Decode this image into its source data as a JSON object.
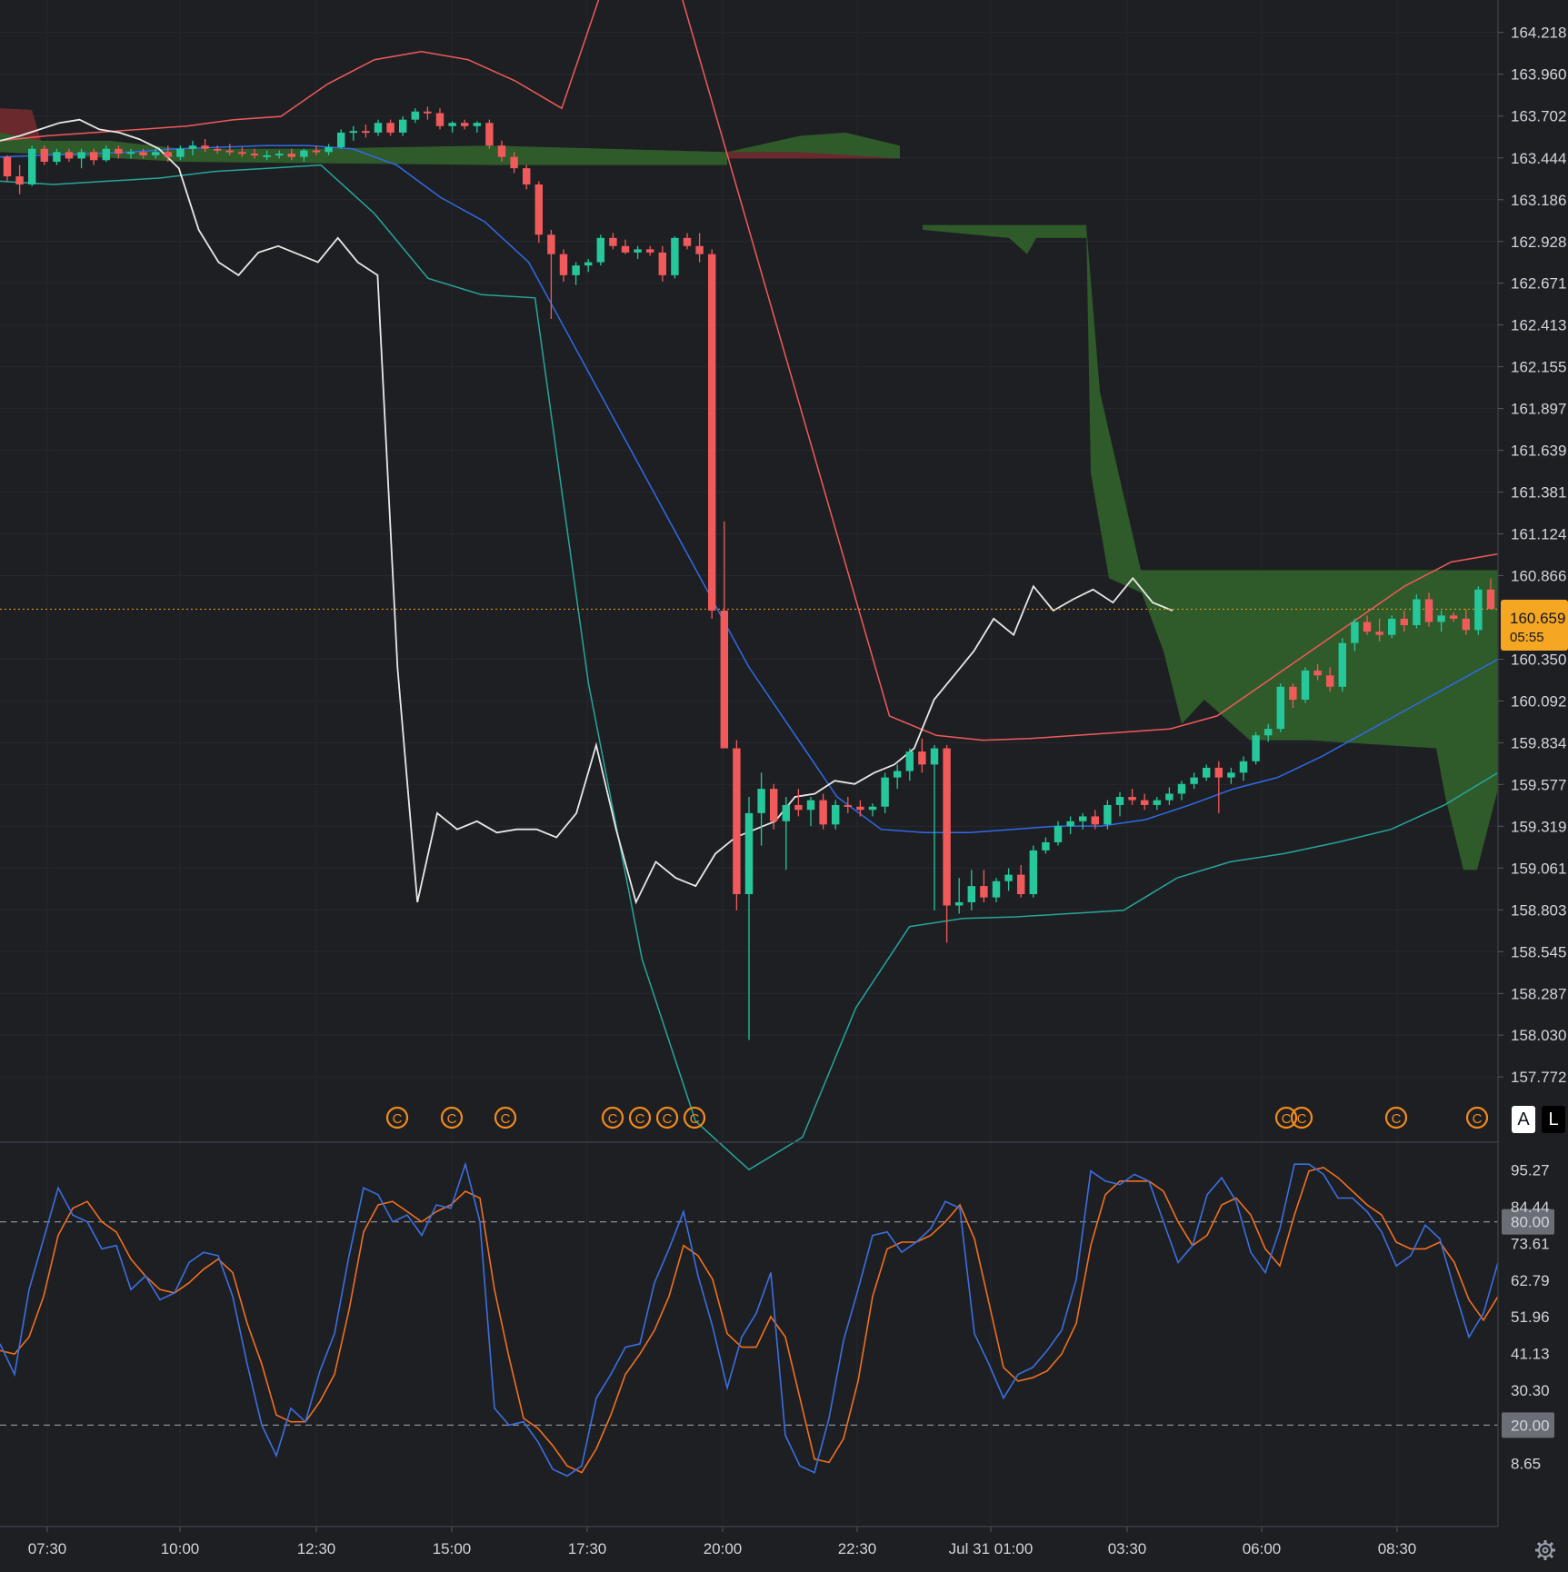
{
  "chart_data": [
    {
      "type": "candlestick",
      "panel": "price",
      "y_ticks": [
        "164.218",
        "163.960",
        "163.702",
        "163.444",
        "163.186",
        "162.928",
        "162.671",
        "162.413",
        "162.155",
        "161.897",
        "161.639",
        "161.381",
        "161.124",
        "160.866",
        "160.350",
        "160.092",
        "159.834",
        "159.577",
        "159.319",
        "159.061",
        "158.803",
        "158.545",
        "158.287",
        "158.030",
        "157.772"
      ],
      "ylim": [
        157.7,
        164.35
      ],
      "x_labels": [
        "07:30",
        "10:00",
        "12:30",
        "15:00",
        "17:30",
        "20:00",
        "22:30",
        "Jul 31 01:00",
        "03:30",
        "06:00",
        "08:30"
      ],
      "current_price": "160.659",
      "countdown": "05:55",
      "colors": {
        "up": "#26c79b",
        "down": "#f05a5a",
        "cloud_green": "#3d6b35",
        "cloud_red": "#7a2a2e",
        "price_line": "#f0a020"
      },
      "candles_ohlc": [
        [
          163.45,
          163.46,
          163.3,
          163.33
        ],
        [
          163.33,
          163.4,
          163.22,
          163.28
        ],
        [
          163.28,
          163.52,
          163.27,
          163.5
        ],
        [
          163.5,
          163.52,
          163.4,
          163.42
        ],
        [
          163.42,
          163.5,
          163.4,
          163.48
        ],
        [
          163.48,
          163.5,
          163.42,
          163.44
        ],
        [
          163.44,
          163.5,
          163.38,
          163.48
        ],
        [
          163.48,
          163.5,
          163.4,
          163.43
        ],
        [
          163.43,
          163.52,
          163.42,
          163.5
        ],
        [
          163.5,
          163.52,
          163.44,
          163.47
        ],
        [
          163.47,
          163.5,
          163.44,
          163.48
        ],
        [
          163.48,
          163.5,
          163.44,
          163.46
        ],
        [
          163.46,
          163.5,
          163.44,
          163.48
        ],
        [
          163.48,
          163.52,
          163.42,
          163.45
        ],
        [
          163.45,
          163.52,
          163.43,
          163.5
        ],
        [
          163.5,
          163.55,
          163.46,
          163.52
        ],
        [
          163.52,
          163.56,
          163.48,
          163.5
        ],
        [
          163.5,
          163.52,
          163.47,
          163.49
        ],
        [
          163.49,
          163.53,
          163.46,
          163.48
        ],
        [
          163.48,
          163.51,
          163.45,
          163.47
        ],
        [
          163.47,
          163.5,
          163.44,
          163.46
        ],
        [
          163.46,
          163.49,
          163.43,
          163.46
        ],
        [
          163.46,
          163.49,
          163.44,
          163.47
        ],
        [
          163.47,
          163.5,
          163.43,
          163.45
        ],
        [
          163.45,
          163.5,
          163.42,
          163.49
        ],
        [
          163.49,
          163.52,
          163.46,
          163.48
        ],
        [
          163.48,
          163.53,
          163.46,
          163.51
        ],
        [
          163.51,
          163.62,
          163.5,
          163.6
        ],
        [
          163.6,
          163.64,
          163.55,
          163.61
        ],
        [
          163.61,
          163.65,
          163.57,
          163.6
        ],
        [
          163.6,
          163.68,
          163.58,
          163.66
        ],
        [
          163.66,
          163.68,
          163.58,
          163.6
        ],
        [
          163.6,
          163.7,
          163.58,
          163.68
        ],
        [
          163.68,
          163.75,
          163.66,
          163.73
        ],
        [
          163.73,
          163.76,
          163.68,
          163.72
        ],
        [
          163.72,
          163.75,
          163.62,
          163.64
        ],
        [
          163.64,
          163.67,
          163.6,
          163.66
        ],
        [
          163.66,
          163.68,
          163.62,
          163.64
        ],
        [
          163.64,
          163.67,
          163.6,
          163.66
        ],
        [
          163.66,
          163.68,
          163.5,
          163.52
        ],
        [
          163.52,
          163.55,
          163.42,
          163.45
        ],
        [
          163.45,
          163.48,
          163.35,
          163.38
        ],
        [
          163.38,
          163.4,
          163.25,
          163.28
        ],
        [
          163.28,
          163.3,
          162.92,
          162.97
        ],
        [
          162.97,
          163.0,
          162.45,
          162.85
        ],
        [
          162.85,
          162.88,
          162.68,
          162.72
        ],
        [
          162.72,
          162.8,
          162.66,
          162.78
        ],
        [
          162.78,
          162.82,
          162.74,
          162.8
        ],
        [
          162.8,
          162.97,
          162.78,
          162.95
        ],
        [
          162.95,
          162.98,
          162.88,
          162.9
        ],
        [
          162.9,
          162.94,
          162.85,
          162.86
        ],
        [
          162.86,
          162.9,
          162.82,
          162.88
        ],
        [
          162.88,
          162.9,
          162.84,
          162.86
        ],
        [
          162.86,
          162.9,
          162.68,
          162.72
        ],
        [
          162.72,
          162.96,
          162.7,
          162.95
        ],
        [
          162.95,
          162.98,
          162.88,
          162.9
        ],
        [
          162.9,
          162.98,
          162.8,
          162.85
        ],
        [
          162.85,
          162.88,
          160.6,
          160.65
        ],
        [
          160.65,
          161.2,
          159.8,
          159.8
        ],
        [
          159.8,
          159.85,
          158.8,
          158.9
        ],
        [
          158.9,
          159.5,
          158.0,
          159.4
        ],
        [
          159.4,
          159.65,
          159.2,
          159.55
        ],
        [
          159.55,
          159.58,
          159.3,
          159.35
        ],
        [
          159.35,
          159.5,
          159.05,
          159.45
        ],
        [
          159.45,
          159.55,
          159.38,
          159.42
        ],
        [
          159.42,
          159.5,
          159.32,
          159.48
        ],
        [
          159.48,
          159.52,
          159.3,
          159.33
        ],
        [
          159.33,
          159.48,
          159.3,
          159.45
        ],
        [
          159.45,
          159.5,
          159.4,
          159.44
        ],
        [
          159.44,
          159.48,
          159.38,
          159.42
        ],
        [
          159.42,
          159.46,
          159.38,
          159.44
        ],
        [
          159.44,
          159.65,
          159.4,
          159.62
        ],
        [
          159.62,
          159.7,
          159.55,
          159.66
        ],
        [
          159.66,
          159.8,
          159.6,
          159.78
        ],
        [
          159.78,
          159.86,
          159.65,
          159.7
        ],
        [
          159.7,
          159.82,
          158.8,
          159.8
        ],
        [
          159.8,
          159.82,
          158.6,
          158.83
        ],
        [
          158.83,
          159.0,
          158.78,
          158.85
        ],
        [
          158.85,
          159.05,
          158.8,
          158.95
        ],
        [
          158.95,
          159.05,
          158.85,
          158.88
        ],
        [
          158.88,
          159.0,
          158.85,
          158.98
        ],
        [
          158.98,
          159.06,
          158.92,
          159.02
        ],
        [
          159.02,
          159.08,
          158.88,
          158.9
        ],
        [
          158.9,
          159.2,
          158.88,
          159.17
        ],
        [
          159.17,
          159.25,
          159.15,
          159.22
        ],
        [
          159.22,
          159.35,
          159.2,
          159.32
        ],
        [
          159.32,
          159.38,
          159.27,
          159.35
        ],
        [
          159.35,
          159.4,
          159.3,
          159.38
        ],
        [
          159.38,
          159.42,
          159.3,
          159.33
        ],
        [
          159.33,
          159.48,
          159.3,
          159.45
        ],
        [
          159.45,
          159.53,
          159.38,
          159.5
        ],
        [
          159.5,
          159.55,
          159.45,
          159.48
        ],
        [
          159.48,
          159.52,
          159.42,
          159.45
        ],
        [
          159.45,
          159.5,
          159.42,
          159.48
        ],
        [
          159.48,
          159.56,
          159.45,
          159.52
        ],
        [
          159.52,
          159.6,
          159.48,
          159.58
        ],
        [
          159.58,
          159.65,
          159.55,
          159.62
        ],
        [
          159.62,
          159.7,
          159.6,
          159.68
        ],
        [
          159.68,
          159.72,
          159.4,
          159.62
        ],
        [
          159.62,
          159.68,
          159.58,
          159.65
        ],
        [
          159.65,
          159.75,
          159.6,
          159.72
        ],
        [
          159.72,
          159.9,
          159.7,
          159.88
        ],
        [
          159.88,
          159.95,
          159.84,
          159.92
        ],
        [
          159.92,
          160.2,
          159.9,
          160.18
        ],
        [
          160.18,
          160.2,
          160.05,
          160.1
        ],
        [
          160.1,
          160.3,
          160.08,
          160.28
        ],
        [
          160.28,
          160.32,
          160.22,
          160.25
        ],
        [
          160.25,
          160.3,
          160.15,
          160.18
        ],
        [
          160.18,
          160.48,
          160.15,
          160.45
        ],
        [
          160.45,
          160.6,
          160.4,
          160.58
        ],
        [
          160.58,
          160.62,
          160.5,
          160.52
        ],
        [
          160.52,
          160.6,
          160.46,
          160.5
        ],
        [
          160.5,
          160.62,
          160.48,
          160.6
        ],
        [
          160.6,
          160.65,
          160.52,
          160.56
        ],
        [
          160.56,
          160.75,
          160.54,
          160.72
        ],
        [
          160.72,
          160.76,
          160.55,
          160.58
        ],
        [
          160.58,
          160.65,
          160.52,
          160.62
        ],
        [
          160.62,
          160.64,
          160.58,
          160.6
        ],
        [
          160.6,
          160.66,
          160.5,
          160.53
        ],
        [
          160.53,
          160.8,
          160.5,
          160.78
        ],
        [
          160.78,
          160.85,
          160.72,
          160.66
        ]
      ],
      "series": [
        {
          "label": "white line",
          "color": "#e8e8e8",
          "values": [
            163.55,
            163.58,
            163.62,
            163.66,
            163.68,
            163.62,
            163.6,
            163.56,
            163.5,
            163.38,
            163.0,
            162.8,
            162.72,
            162.86,
            162.9,
            162.85,
            162.8,
            162.95,
            162.8,
            162.72,
            160.3,
            158.85,
            159.4,
            159.3,
            159.35,
            159.28,
            159.3,
            159.3,
            159.25,
            159.4,
            159.82,
            159.3,
            158.85,
            159.1,
            159.0,
            158.95,
            159.15,
            159.25,
            159.3,
            159.35,
            159.5,
            159.52,
            159.6,
            159.58,
            159.65,
            159.7,
            159.8,
            160.1,
            160.25,
            160.4,
            160.6,
            160.5,
            160.8,
            160.65,
            160.72,
            160.78,
            160.7,
            160.85,
            160.7,
            160.65
          ]
        },
        {
          "label": "Bollinger basis",
          "color": "#2f6be8",
          "values": [
            163.45,
            163.46,
            163.47,
            163.48,
            163.5,
            163.51,
            163.52,
            163.52,
            163.5,
            163.4,
            163.2,
            163.05,
            162.8,
            162.3,
            161.8,
            161.3,
            160.8,
            160.3,
            159.9,
            159.5,
            159.3,
            159.28,
            159.28,
            159.3,
            159.32,
            159.32,
            159.36,
            159.45,
            159.55,
            159.62,
            159.75,
            159.9,
            160.05,
            160.2,
            160.35
          ]
        },
        {
          "label": "Bollinger upper",
          "color": "#f05a5a",
          "values": [
            163.55,
            163.58,
            163.6,
            163.62,
            163.64,
            163.68,
            163.7,
            163.9,
            164.05,
            164.1,
            164.05,
            163.92,
            163.75,
            164.6,
            165.0,
            164.0,
            163.0,
            162.0,
            161.0,
            160.0,
            159.88,
            159.85,
            159.86,
            159.88,
            159.9,
            159.92,
            160.0,
            160.2,
            160.4,
            160.6,
            160.8,
            160.95,
            161.0
          ]
        },
        {
          "label": "Bollinger lower",
          "color": "#26a69a",
          "values": [
            163.3,
            163.28,
            163.3,
            163.32,
            163.36,
            163.38,
            163.4,
            163.1,
            162.7,
            162.6,
            162.58,
            160.2,
            158.5,
            157.5,
            157.2,
            157.4,
            158.2,
            158.7,
            158.75,
            158.76,
            158.78,
            158.8,
            159.0,
            159.1,
            159.15,
            159.22,
            159.3,
            159.45,
            159.65
          ]
        }
      ],
      "markers": {
        "label": "C",
        "count": 12
      }
    },
    {
      "type": "line",
      "panel": "stochastic",
      "y_ticks": [
        "95.27",
        "84.44",
        "73.61",
        "62.79",
        "51.96",
        "41.13",
        "30.30",
        "8.65"
      ],
      "levels": [
        "80.00",
        "20.00"
      ],
      "ylim": [
        0,
        100
      ],
      "series": [
        {
          "label": "%K",
          "color": "#3b6fe0",
          "values": [
            44,
            35,
            60,
            75,
            90,
            82,
            80,
            72,
            73,
            60,
            64,
            57,
            59,
            68,
            71,
            70,
            58,
            38,
            20,
            11,
            25,
            21,
            36,
            47,
            70,
            90,
            88,
            80,
            82,
            76,
            85,
            84,
            97,
            80,
            25,
            20,
            21,
            15,
            7,
            5,
            8,
            28,
            35,
            43,
            44,
            62,
            72,
            83,
            64,
            49,
            31,
            46,
            53,
            65,
            17,
            8,
            6,
            22,
            45,
            60,
            76,
            77,
            71,
            74,
            78,
            86,
            84,
            47,
            38,
            28,
            35,
            37,
            42,
            48,
            63,
            95,
            92,
            91,
            94,
            92,
            80,
            68,
            73,
            88,
            93,
            86,
            71,
            65,
            78,
            97,
            97,
            94,
            87,
            87,
            83,
            77,
            67,
            70,
            79,
            75,
            60,
            46,
            53,
            68
          ]
        },
        {
          "label": "%D",
          "color": "#f07020",
          "values": [
            42,
            41,
            46,
            58,
            76,
            84,
            86,
            80,
            77,
            69,
            64,
            60,
            59,
            62,
            66,
            69,
            65,
            50,
            38,
            23,
            21,
            21,
            27,
            35,
            54,
            77,
            85,
            86,
            83,
            80,
            83,
            85,
            89,
            87,
            60,
            40,
            22,
            19,
            14,
            8,
            6,
            13,
            23,
            35,
            41,
            48,
            58,
            73,
            70,
            63,
            47,
            43,
            43,
            52,
            46,
            28,
            10,
            9,
            16,
            33,
            58,
            72,
            74,
            74,
            76,
            80,
            85,
            75,
            56,
            37,
            33,
            34,
            36,
            41,
            50,
            73,
            88,
            92,
            92,
            92,
            89,
            80,
            73,
            76,
            85,
            87,
            82,
            72,
            67,
            82,
            95,
            96,
            93,
            89,
            85,
            82,
            74,
            72,
            72,
            74,
            68,
            57,
            51,
            58
          ]
        }
      ]
    }
  ],
  "controls": {
    "auto": "A",
    "log": "L"
  }
}
